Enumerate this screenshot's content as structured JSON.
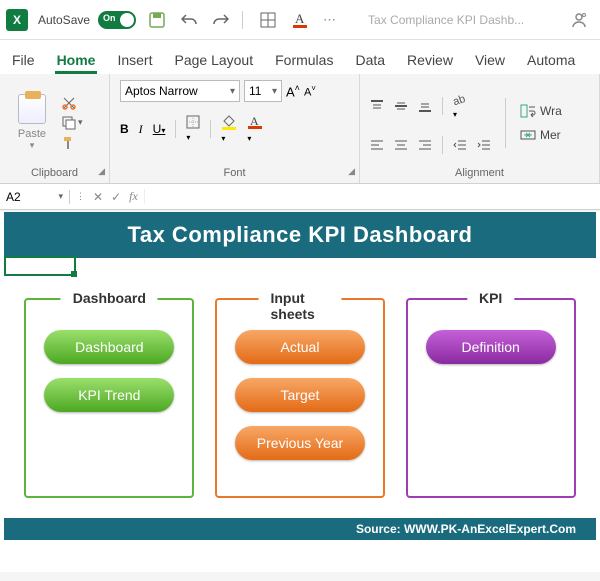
{
  "titlebar": {
    "autosave_label": "AutoSave",
    "toggle_text": "On",
    "doc_title": "Tax Compliance KPI Dashb..."
  },
  "tabs": {
    "file": "File",
    "home": "Home",
    "insert": "Insert",
    "page_layout": "Page Layout",
    "formulas": "Formulas",
    "data": "Data",
    "review": "Review",
    "view": "View",
    "automate": "Automa"
  },
  "ribbon": {
    "clipboard": {
      "paste_label": "Paste",
      "group_label": "Clipboard"
    },
    "font": {
      "font_name": "Aptos Narrow",
      "font_size": "11",
      "bold": "B",
      "italic": "I",
      "underline": "U",
      "group_label": "Font"
    },
    "alignment": {
      "wrap": "Wra",
      "merge": "Mer",
      "group_label": "Alignment"
    }
  },
  "formula_bar": {
    "name_box": "A2",
    "fx": "fx"
  },
  "dashboard": {
    "banner": "Tax Compliance KPI Dashboard",
    "card1": {
      "title": "Dashboard",
      "btn1": "Dashboard",
      "btn2": "KPI Trend"
    },
    "card2": {
      "title": "Input sheets",
      "btn1": "Actual",
      "btn2": "Target",
      "btn3": "Previous Year"
    },
    "card3": {
      "title": "KPI",
      "btn1": "Definition"
    },
    "source": "Source: WWW.PK-AnExcelExpert.Com"
  }
}
